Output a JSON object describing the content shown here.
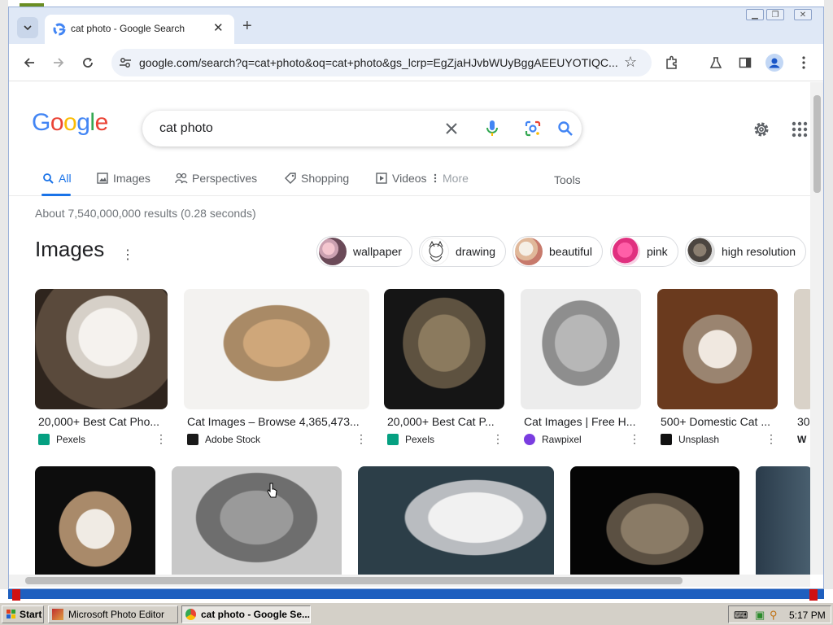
{
  "browser": {
    "tab_title": "cat photo - Google Search",
    "url": "google.com/search?q=cat+photo&oq=cat+photo&gs_lcrp=EgZjaHJvbWUyBggAEEUYOTIQC..."
  },
  "google": {
    "logo": "Google",
    "query": "cat photo",
    "nav": {
      "all": "All",
      "images": "Images",
      "perspectives": "Perspectives",
      "shopping": "Shopping",
      "videos": "Videos",
      "more": "More",
      "tools": "Tools"
    },
    "stats": "About 7,540,000,000 results (0.28 seconds)",
    "images_heading": "Images",
    "chips": [
      "wallpaper",
      "drawing",
      "beautiful",
      "pink",
      "high resolution"
    ],
    "results_row1": [
      {
        "caption": "20,000+ Best Cat Pho...",
        "source": "Pexels"
      },
      {
        "caption": "Cat Images – Browse 4,365,473...",
        "source": "Adobe Stock"
      },
      {
        "caption": "20,000+ Best Cat P...",
        "source": "Pexels"
      },
      {
        "caption": "Cat Images | Free H...",
        "source": "Rawpixel"
      },
      {
        "caption": "500+ Domestic Cat ...",
        "source": "Unsplash"
      },
      {
        "caption": "30",
        "source": "W"
      }
    ]
  },
  "taskbar": {
    "start": "Start",
    "task1": "Microsoft Photo Editor",
    "task2": "cat photo - Google Se...",
    "clock": "5:17 PM"
  },
  "colors": {
    "google_blue": "#4285F4",
    "google_red": "#EA4335",
    "google_yellow": "#FBBC05",
    "google_green": "#34A853",
    "link_blue": "#1a73e8"
  }
}
